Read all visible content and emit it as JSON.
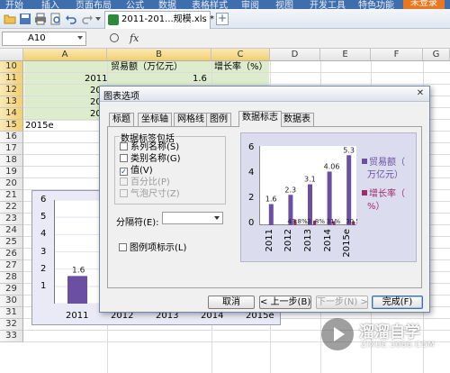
{
  "menu": {
    "items": [
      "开始",
      "插入",
      "页面布局",
      "公式",
      "数据",
      "表格样式",
      "审阅",
      "视图",
      "开发工具",
      "特色功能"
    ],
    "login": "未登录"
  },
  "toolbar": {
    "doc_tab": "2011-201...规模.xls *",
    "new_tab": "+"
  },
  "formula_bar": {
    "name_box": "A10",
    "fx": "fx"
  },
  "sheet": {
    "columns": [
      "A",
      "B",
      "C",
      "D",
      "E",
      "F",
      "G"
    ],
    "rows": [
      "10",
      "11",
      "12",
      "13",
      "14",
      "15",
      "16",
      "17",
      "18",
      "19",
      "20",
      "21",
      "22",
      "23",
      "24",
      "25",
      "26",
      "27",
      "28",
      "29",
      "30",
      "31",
      "32",
      "33"
    ],
    "header_b": "贸易额（万亿元）",
    "header_c": "增长率（%）",
    "year_2011": "2011",
    "val_2011": "1.6",
    "year_2012": "20",
    "year_2013": "20",
    "year_2014": "20",
    "cell_2015e": "2015e"
  },
  "chart": {
    "y_ticks": [
      "6",
      "5",
      "4",
      "3",
      "2",
      "1"
    ],
    "data_label": "1.6",
    "x_ticks": [
      "2011",
      "2012",
      "2013",
      "2014",
      "2015e"
    ]
  },
  "dialog": {
    "title": "图表选项",
    "close": "✕",
    "tabs": [
      "标题",
      "坐标轴",
      "网格线",
      "图例",
      "数据标志",
      "数据表"
    ],
    "active_tab": 4,
    "group_title": "数据标签包括",
    "options": [
      {
        "label": "系列名称(S)",
        "checked": false,
        "disabled": false
      },
      {
        "label": "类别名称(G)",
        "checked": false,
        "disabled": false
      },
      {
        "label": "值(V)",
        "checked": true,
        "disabled": false
      },
      {
        "label": "百分比(P)",
        "checked": false,
        "disabled": true
      },
      {
        "label": "气泡尺寸(Z)",
        "checked": false,
        "disabled": true
      }
    ],
    "separator_label": "分隔符(E):",
    "legend_key_label": "图例项标示(L)",
    "buttons": {
      "cancel": "取消",
      "back": "< 上一步(B)",
      "next": "下一步(N) >",
      "finish": "完成(F)"
    }
  },
  "preview_chart": {
    "y_ticks": [
      "6",
      "4",
      "2",
      "0"
    ],
    "legend": [
      "贸易额（",
      "万亿元）",
      "增长率（",
      "%）"
    ],
    "bar_color": "#6a4fa3",
    "growth_color": "#9c2d6a"
  },
  "chart_data": {
    "type": "bar",
    "categories": [
      "2011",
      "2012",
      "2013",
      "2014",
      "2015e"
    ],
    "series": [
      {
        "name": "贸易额（万亿元）",
        "values": [
          1.6,
          2.3,
          3.1,
          4.06,
          5.3
        ],
        "labels": [
          "1.6",
          "2.3",
          "3.1",
          "4.06",
          "5.3"
        ]
      },
      {
        "name": "增长率（%）",
        "values": [
          0.0,
          0.438,
          0.348,
          0.31,
          0.305
        ],
        "labels": [
          "",
          "43.8%",
          "3 .8%",
          "31%",
          "30.5%"
        ]
      }
    ],
    "ylim": [
      0,
      6
    ]
  },
  "watermark": {
    "name": "溜溜自学",
    "sub": "ZIXUE.3066.COM"
  }
}
